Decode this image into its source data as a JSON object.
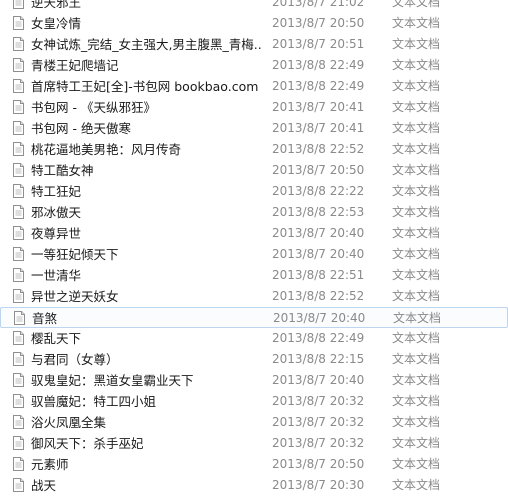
{
  "files": [
    {
      "name": "逆天邪王",
      "date": "2013/8/7 21:02",
      "type": "文本文档"
    },
    {
      "name": "女皇冷情",
      "date": "2013/8/7 20:50",
      "type": "文本文档"
    },
    {
      "name": "女神试炼_完结_女主强大,男主腹黑_青梅...",
      "date": "2013/8/7 20:51",
      "type": "文本文档"
    },
    {
      "name": "青楼王妃爬墙记",
      "date": "2013/8/8 22:49",
      "type": "文本文档"
    },
    {
      "name": "首席特工王妃[全]-书包网 bookbao.com",
      "date": "2013/8/8 22:49",
      "type": "文本文档"
    },
    {
      "name": "书包网 - 《天纵邪狂》",
      "date": "2013/8/7 20:41",
      "type": "文本文档"
    },
    {
      "name": "书包网 - 绝天傲寒",
      "date": "2013/8/7 20:41",
      "type": "文本文档"
    },
    {
      "name": "桃花逼地美男艳：风月传奇",
      "date": "2013/8/8 22:52",
      "type": "文本文档"
    },
    {
      "name": "特工酷女神",
      "date": "2013/8/7 20:50",
      "type": "文本文档"
    },
    {
      "name": "特工狂妃",
      "date": "2013/8/8 22:22",
      "type": "文本文档"
    },
    {
      "name": "邪冰傲天",
      "date": "2013/8/8 22:53",
      "type": "文本文档"
    },
    {
      "name": "夜尊异世",
      "date": "2013/8/7 20:40",
      "type": "文本文档"
    },
    {
      "name": "一等狂妃倾天下",
      "date": "2013/8/7 20:40",
      "type": "文本文档"
    },
    {
      "name": "一世清华",
      "date": "2013/8/8 22:51",
      "type": "文本文档"
    },
    {
      "name": "异世之逆天妖女",
      "date": "2013/8/8 22:52",
      "type": "文本文档"
    },
    {
      "name": "音煞",
      "date": "2013/8/7 20:40",
      "type": "文本文档",
      "selected": true
    },
    {
      "name": "樱乱天下",
      "date": "2013/8/8 22:49",
      "type": "文本文档"
    },
    {
      "name": "与君同（女尊）",
      "date": "2013/8/8 22:15",
      "type": "文本文档"
    },
    {
      "name": "驭鬼皇妃：黑道女皇霸业天下",
      "date": "2013/8/7 20:40",
      "type": "文本文档"
    },
    {
      "name": "驭兽魔妃：特工四小姐",
      "date": "2013/8/7 20:32",
      "type": "文本文档"
    },
    {
      "name": "浴火凤凰全集",
      "date": "2013/8/7 20:32",
      "type": "文本文档"
    },
    {
      "name": "御风天下：杀手巫妃",
      "date": "2013/8/7 20:32",
      "type": "文本文档"
    },
    {
      "name": "元素师",
      "date": "2013/8/7 20:50",
      "type": "文本文档"
    },
    {
      "name": "战天",
      "date": "2013/8/7 20:30",
      "type": "文本文档"
    }
  ]
}
